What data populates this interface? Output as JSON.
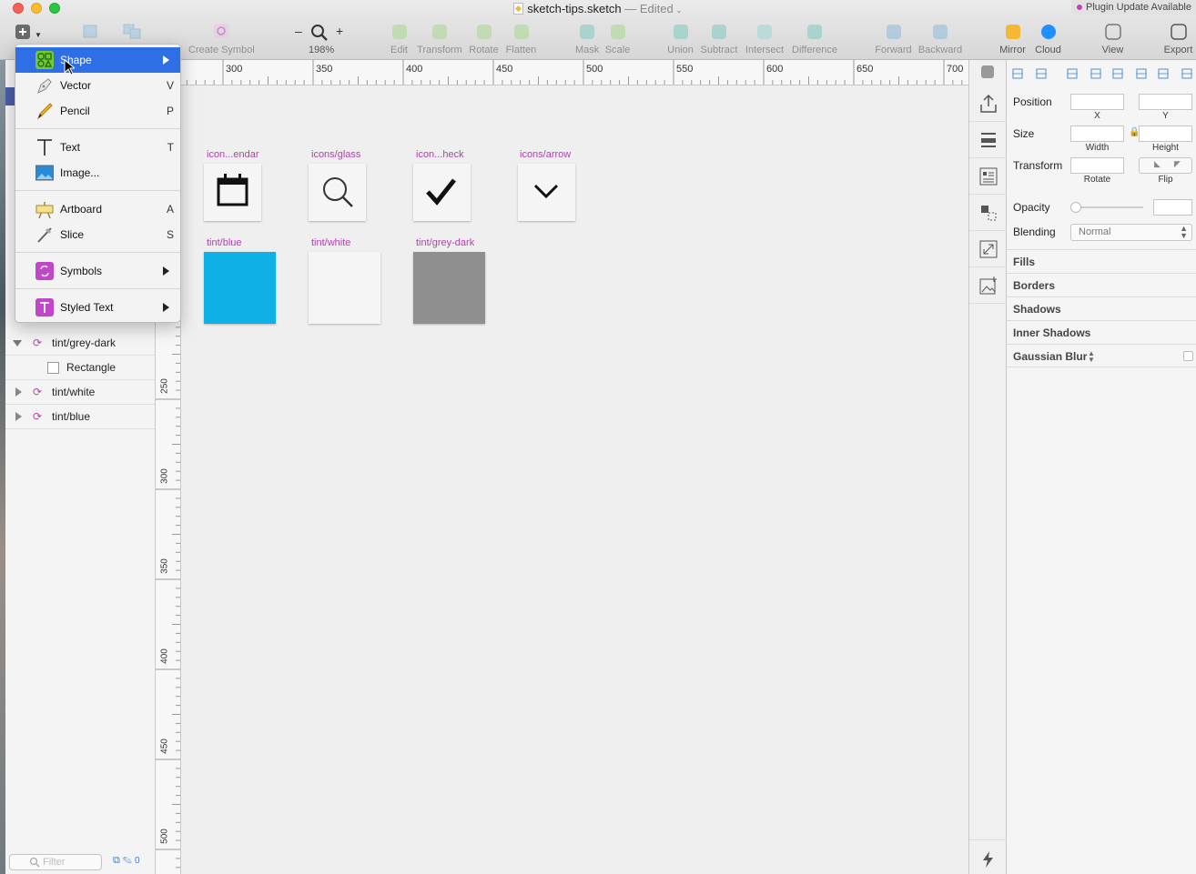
{
  "window": {
    "file_name": "sketch-tips.sketch",
    "edited_label": "— Edited",
    "plugin_badge": "Plugin Update Available"
  },
  "toolbar": {
    "create_symbol": "Create Symbol",
    "zoom_level": "198%",
    "zoom_minus": "–",
    "zoom_plus": "+",
    "items": [
      "Edit",
      "Transform",
      "Rotate",
      "Flatten",
      "Mask",
      "Scale",
      "Union",
      "Subtract",
      "Intersect",
      "Difference",
      "Forward",
      "Backward",
      "Mirror",
      "Cloud",
      "View",
      "Export"
    ]
  },
  "insert_menu": {
    "items": [
      {
        "label": "Shape",
        "key": "",
        "submenu": true,
        "icon": "shape-icon"
      },
      {
        "label": "Vector",
        "key": "V",
        "submenu": false,
        "icon": "pen-icon"
      },
      {
        "label": "Pencil",
        "key": "P",
        "submenu": false,
        "icon": "pencil-icon"
      },
      {
        "label": "Text",
        "key": "T",
        "submenu": false,
        "icon": "text-icon"
      },
      {
        "label": "Image...",
        "key": "",
        "submenu": false,
        "icon": "image-icon"
      },
      {
        "label": "Artboard",
        "key": "A",
        "submenu": false,
        "icon": "artboard-icon"
      },
      {
        "label": "Slice",
        "key": "S",
        "submenu": false,
        "icon": "slice-icon"
      },
      {
        "label": "Symbols",
        "key": "",
        "submenu": true,
        "icon": "symbols-icon"
      },
      {
        "label": "Styled Text",
        "key": "",
        "submenu": true,
        "icon": "styled-text-icon"
      }
    ]
  },
  "layers": [
    {
      "name": "tint/grey-dark",
      "expanded": true
    },
    {
      "name": "Rectangle",
      "child": true
    },
    {
      "name": "tint/white",
      "expanded": false
    },
    {
      "name": "tint/blue",
      "expanded": false
    }
  ],
  "sidebar": {
    "filter_placeholder": "Filter",
    "tools_count": "0"
  },
  "ruler_top": [
    "300",
    "350",
    "400",
    "450",
    "500",
    "550",
    "600",
    "650",
    "700"
  ],
  "ruler_left": [
    "250",
    "300",
    "350",
    "400",
    "450",
    "500"
  ],
  "canvas": {
    "symbols": [
      {
        "label": "icon...endar",
        "icon": "calendar-icon"
      },
      {
        "label": "icons/glass",
        "icon": "magnifier-icon"
      },
      {
        "label": "icon...heck",
        "icon": "check-icon"
      },
      {
        "label": "icons/arrow",
        "icon": "chevron-down-icon"
      }
    ],
    "tints": [
      {
        "label": "tint/blue",
        "color": "#0fb0e6"
      },
      {
        "label": "tint/white",
        "color": "#f5f5f5"
      },
      {
        "label": "tint/grey-dark",
        "color": "#8f8f8f"
      }
    ]
  },
  "inspector": {
    "position_label": "Position",
    "x_label": "X",
    "y_label": "Y",
    "size_label": "Size",
    "width_label": "Width",
    "height_label": "Height",
    "transform_label": "Transform",
    "rotate_label": "Rotate",
    "flip_label": "Flip",
    "opacity_label": "Opacity",
    "blending_label": "Blending",
    "blending_value": "Normal",
    "sections": [
      "Fills",
      "Borders",
      "Shadows",
      "Inner Shadows",
      "Gaussian Blur"
    ]
  },
  "colors": {
    "accent": "#2f6fe6",
    "symbol_purple": "#b040b0",
    "tint_blue": "#0fb0e6",
    "tint_grey_dark": "#8f8f8f"
  }
}
